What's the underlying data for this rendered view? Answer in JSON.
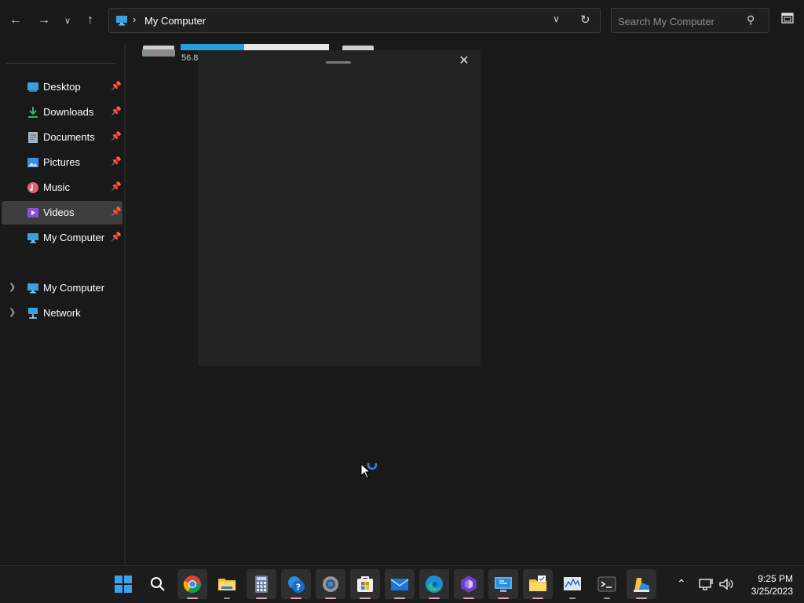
{
  "toolbar": {
    "back_icon": "back-arrow-icon",
    "forward_icon": "forward-arrow-icon",
    "recent_icon": "chevron-down-icon",
    "up_icon": "up-arrow-icon",
    "address": "My Computer",
    "search_placeholder": "Search My Computer"
  },
  "sidebar": {
    "quick_access": [
      {
        "label": "Desktop",
        "icon": "desktop-icon",
        "color": "#3aa0e0"
      },
      {
        "label": "Downloads",
        "icon": "download-icon",
        "color": "#34b36f"
      },
      {
        "label": "Documents",
        "icon": "documents-icon",
        "color": "#a8b4c4"
      },
      {
        "label": "Pictures",
        "icon": "pictures-icon",
        "color": "#3a8ee6"
      },
      {
        "label": "Music",
        "icon": "music-icon",
        "color": "#e0607a"
      },
      {
        "label": "Videos",
        "icon": "videos-icon",
        "color": "#8a4fd8",
        "selected": true
      },
      {
        "label": "My Computer",
        "icon": "computer-icon",
        "color": "#3aa0e0"
      }
    ],
    "tree": [
      {
        "label": "My Computer",
        "icon": "computer-icon"
      },
      {
        "label": "Network",
        "icon": "network-icon"
      }
    ]
  },
  "content": {
    "drive_free_text": "56.8",
    "drive_used_fraction": 0.43,
    "accent": "#26a0da"
  },
  "popup": {
    "close_icon": "close-icon"
  },
  "taskbar": {
    "apps": [
      "start-icon",
      "search-icon",
      "chrome-icon",
      "file-explorer-icon",
      "calculator-icon",
      "get-help-icon",
      "settings-icon",
      "microsoft-store-icon",
      "mail-icon",
      "edge-icon",
      "clipchamp-icon",
      "remote-desktop-icon",
      "sticky-notes-folder-icon",
      "resource-monitor-icon",
      "terminal-icon",
      "paint-icon"
    ],
    "time": "9:25 PM",
    "date": "3/25/2023"
  }
}
